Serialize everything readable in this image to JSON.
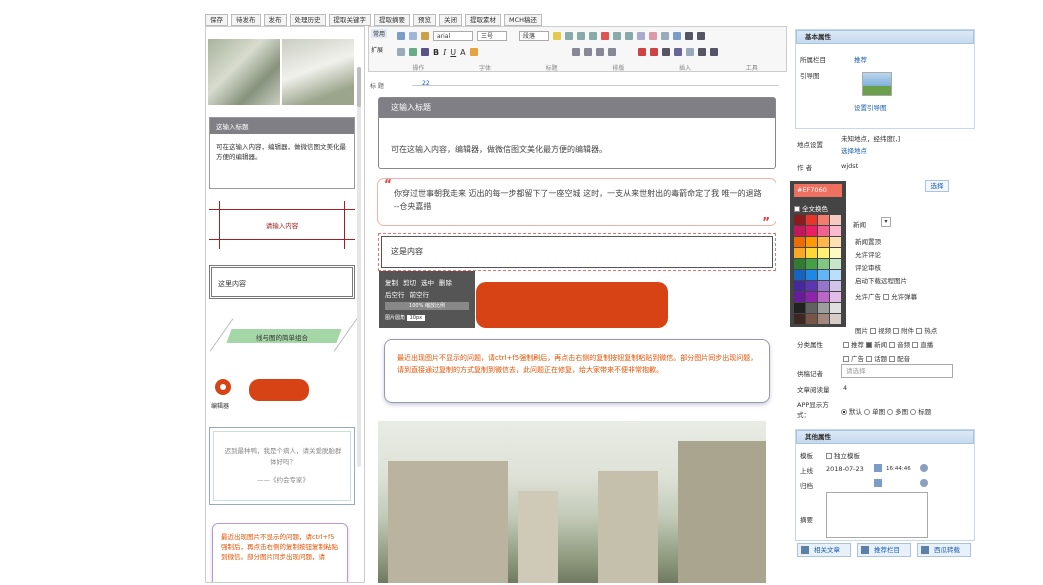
{
  "topbar": {
    "buttons": [
      "保存",
      "待发布",
      "发布",
      "处理历史",
      "提取关键字",
      "提取摘要",
      "预览",
      "关闭",
      "提取素材",
      "MCH稿还"
    ]
  },
  "toolbar": {
    "row1_label": "常用",
    "row2_label": "扩展",
    "font_family": "arial",
    "font_size": "三号",
    "paragraph": "段落",
    "groups": [
      "操作",
      "字体",
      "标题",
      "排版",
      "插入",
      "工具"
    ]
  },
  "ruler": {
    "label": "标 题",
    "value": "22"
  },
  "left": {
    "card_title": "这输入标题",
    "card_body": "可在这输入内容，编辑器，做微信图文美化最方便的编辑器。",
    "red_content": "请输入内容",
    "plain_content": "这里内容",
    "green_banner": "线与图的简单组合",
    "editor_label": "编辑器",
    "quote_text": "迟到最种鸭，我是个病人，请关爱脱胎群体好吗？",
    "quote_author": "——《约会专家》",
    "notice_text": "最近出现图片不显示的问题，请ctrl+f5强制后，再点击右侧的复制按钮复制粘贴到微信。部分图片同步出现问题，请"
  },
  "doc": {
    "title": "这输入标题",
    "body": "可在这输入内容，编辑器，做微信图文美化最方便的编辑器。",
    "poem": "你穿过世事朝我走来 迈出的每一步都留下了一座空城 这时，一支从来世射出的毒箭命定了我 唯一的退路 --仓央嘉措",
    "content_box": "这是内容",
    "notice": "最近出现图片不显示的问题，请ctrl+f5强制刷后，再点击右侧的复制按钮复制粘贴到微信。部分图片同步出现问题，请到直接通过复制的方式复制到微信去，此问题正在修复，给大家带来不便非常抱歉。"
  },
  "context_menu": {
    "row1": [
      "复制",
      "剪切",
      "选中",
      "删除"
    ],
    "row2": [
      "后空行",
      "前空行"
    ],
    "zoom": "100%",
    "zoom_label": "缩放比例",
    "extra": "图片圆角",
    "extra_value": "10px"
  },
  "color_picker": {
    "hex": "#EF7060",
    "theme_label": "全文换色",
    "colors": [
      "#8b1a1a",
      "#e8342a",
      "#f07d6e",
      "#f8c9c1",
      "#c2185b",
      "#e91e63",
      "#f06292",
      "#f8bbd0",
      "#ef6c00",
      "#ff9800",
      "#ffb74d",
      "#ffe0b2",
      "#f9a825",
      "#fdd835",
      "#fff176",
      "#fff9c4",
      "#2e7d32",
      "#43a047",
      "#81c784",
      "#c8e6c9",
      "#1565c0",
      "#1e88e5",
      "#64b5f6",
      "#bbdefb",
      "#4527a0",
      "#5e35b1",
      "#9575cd",
      "#d1c4e9",
      "#6a1b9a",
      "#8e24aa",
      "#ba68c8",
      "#e1bee7",
      "#212121",
      "#616161",
      "#9e9e9e",
      "#e0e0e0",
      "#3e2723",
      "#795548",
      "#a1887f",
      "#d7ccc8"
    ]
  },
  "right": {
    "basic_title": "基本属性",
    "column_label": "所属栏目",
    "column_value": "推荐",
    "thumb_label": "引导图",
    "thumb_link": "设置引导图",
    "location_label": "地点设置",
    "location_value": "未知地点，经纬度[,]",
    "location_link": "选择地点",
    "author_label": "作 者",
    "author_value": "wjdst",
    "choose_btn": "选择",
    "news_label": "新闻",
    "opts": [
      "新闻置顶",
      "允许评论",
      "评论审核",
      "启动下载远程图片"
    ],
    "ads": [
      "允许广告",
      "允许弹幕"
    ],
    "attrs_row1": [
      "图片",
      "视频",
      "附件",
      "热点"
    ],
    "class_label": "分类属性",
    "attrs_row2": [
      "推荐",
      "新闻",
      "音频",
      "直播"
    ],
    "attrs_row3": [
      "广告",
      "话题",
      "配音"
    ],
    "tag_label": "供稿记者",
    "tag_placeholder": "请选择",
    "read_label": "文章阅读量",
    "read_value": "4",
    "app_label": "APP显示方式：",
    "app_opts": [
      "默认",
      "单图",
      "多图",
      "标题"
    ],
    "other_title": "其他属性",
    "tpl_label": "模板",
    "tpl_opt": "独立模板",
    "online_label": "上线",
    "online_date": "2018-07-23",
    "online_time": "16:44:46",
    "offline_label": "归档",
    "summary_label": "摘要",
    "buttons": [
      "相关文章",
      "推荐栏目",
      "西瓜转载"
    ]
  }
}
